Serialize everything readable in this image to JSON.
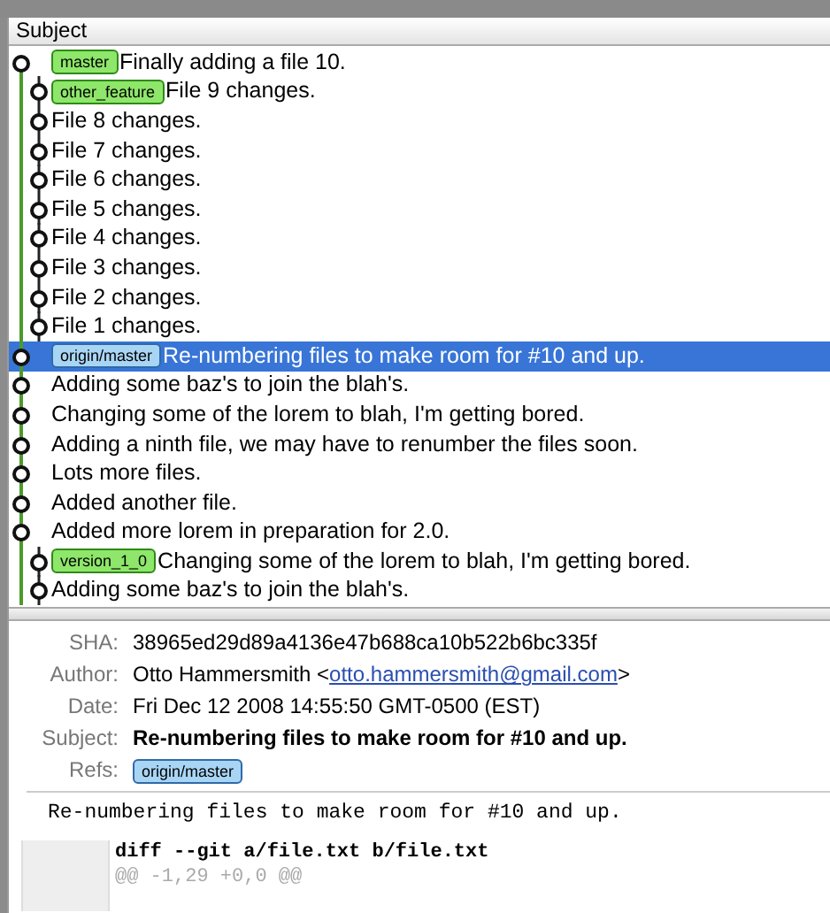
{
  "list": {
    "header": "Subject",
    "rows": [
      {
        "kind": "main",
        "refs": [
          {
            "label": "master",
            "kind": "local"
          }
        ],
        "subject": "Finally adding a file 10.",
        "selected": false
      },
      {
        "kind": "branch",
        "refs": [
          {
            "label": "other_feature",
            "kind": "local"
          }
        ],
        "subject": "File 9 changes.",
        "selected": false
      },
      {
        "kind": "branch",
        "refs": [],
        "subject": "File 8 changes.",
        "selected": false
      },
      {
        "kind": "branch",
        "refs": [],
        "subject": "File 7 changes.",
        "selected": false
      },
      {
        "kind": "branch",
        "refs": [],
        "subject": "File 6 changes.",
        "selected": false
      },
      {
        "kind": "branch",
        "refs": [],
        "subject": "File 5 changes.",
        "selected": false
      },
      {
        "kind": "branch",
        "refs": [],
        "subject": "File 4 changes.",
        "selected": false
      },
      {
        "kind": "branch",
        "refs": [],
        "subject": "File 3 changes.",
        "selected": false
      },
      {
        "kind": "branch",
        "refs": [],
        "subject": "File 2 changes.",
        "selected": false
      },
      {
        "kind": "branch",
        "refs": [],
        "subject": "File 1 changes.",
        "selected": false
      },
      {
        "kind": "main",
        "refs": [
          {
            "label": "origin/master",
            "kind": "remote"
          }
        ],
        "subject": "Re-numbering files to make room for #10 and up.",
        "selected": true
      },
      {
        "kind": "main",
        "refs": [],
        "subject": "Adding some baz's to join the blah's.",
        "selected": false
      },
      {
        "kind": "main",
        "refs": [],
        "subject": "Changing some of the lorem to blah, I'm getting bored.",
        "selected": false
      },
      {
        "kind": "main",
        "refs": [],
        "subject": "Adding a ninth file, we may have to renumber the files soon.",
        "selected": false
      },
      {
        "kind": "main",
        "refs": [],
        "subject": "Lots more files.",
        "selected": false
      },
      {
        "kind": "main",
        "refs": [],
        "subject": "Added another file.",
        "selected": false
      },
      {
        "kind": "main",
        "refs": [],
        "subject": "Added more lorem in preparation for 2.0.",
        "selected": false
      },
      {
        "kind": "branch",
        "refs": [
          {
            "label": "version_1_0",
            "kind": "local"
          }
        ],
        "subject": "Changing some of the lorem to blah, I'm getting bored.",
        "selected": false
      },
      {
        "kind": "branch",
        "refs": [],
        "subject": "Adding some baz's to join the blah's.",
        "selected": false
      }
    ]
  },
  "details": {
    "sha_label": "SHA:",
    "sha": "38965ed29d89a4136e47b688ca10b522b6bc335f",
    "author_label": "Author:",
    "author": "Otto Hammersmith",
    "email_open": "<",
    "email": "otto.hammersmith@gmail.com",
    "email_close": ">",
    "date_label": "Date:",
    "date": "Fri Dec 12 2008 14:55:50 GMT-0500 (EST)",
    "subject_label": "Subject:",
    "subject": "Re-numbering files to make room for #10 and up.",
    "refs_label": "Refs:",
    "refs": [
      {
        "label": "origin/master",
        "kind": "remote"
      }
    ],
    "message": "Re-numbering files to make room for #10 and up."
  },
  "diff": {
    "header": "diff --git a/file.txt b/file.txt",
    "hunk": "@@ -1,29 +0,0 @@"
  }
}
